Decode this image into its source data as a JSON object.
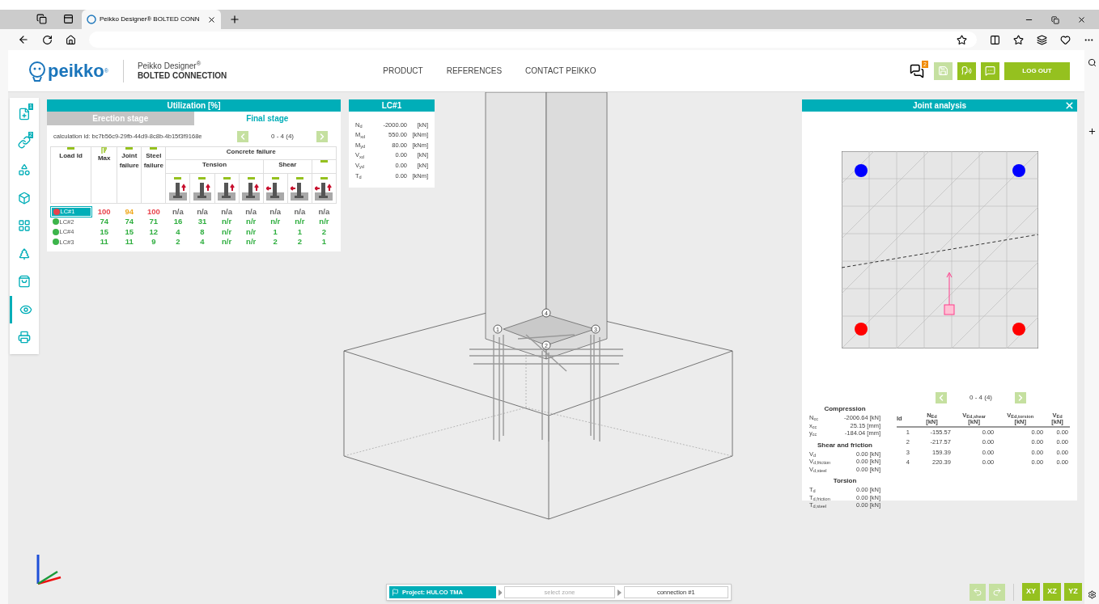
{
  "browser": {
    "tab_title": "Peikko Designer® BOLTED CONN"
  },
  "header": {
    "logo": "peikko",
    "logo_mark": "®",
    "product": "Peikko Designer$^{®}$",
    "subtitle": "BOLTED CONNECTION",
    "nav": [
      "PRODUCT",
      "REFERENCES",
      "CONTACT PEIKKO"
    ],
    "notification_count": "2",
    "save_disabled": true,
    "logout": "LOG OUT"
  },
  "sidebar": {
    "items": [
      {
        "kind": "add",
        "badge": "1",
        "selected": false
      },
      {
        "kind": "link",
        "badge": "2",
        "selected": false
      },
      {
        "kind": "shapes",
        "selected": false
      },
      {
        "kind": "cube",
        "selected": false
      },
      {
        "kind": "grid",
        "selected": false
      },
      {
        "kind": "tree",
        "selected": false
      },
      {
        "kind": "bag",
        "selected": false
      },
      {
        "kind": "view",
        "selected": true
      },
      {
        "kind": "print",
        "selected": false
      }
    ]
  },
  "utilization": {
    "title": "Utilization [%]",
    "tabs": [
      {
        "label": "Erection stage",
        "selected": false
      },
      {
        "label": "Final stage",
        "selected": true
      }
    ],
    "calc_id": "calculation id: bc7b56c9-29fb-44d9-8c8b-4b15f3f9168e",
    "page": "0 - 4 (4)",
    "columns": {
      "load_id": "Load Id",
      "max": "Max",
      "joint": "Joint failure",
      "steel": "Steel failure",
      "concrete": "Concrete failure",
      "tension": "Tension",
      "shear": "Shear"
    },
    "rows": [
      {
        "id": "LC#1",
        "color": "#e8424b",
        "selected": true,
        "cells": [
          {
            "v": "100",
            "color": "#e8424b"
          },
          {
            "v": "94",
            "color": "#f0a81c"
          },
          {
            "v": "100",
            "color": "#e8424b"
          },
          {
            "v": "n/a",
            "color": "#666666"
          },
          {
            "v": "n/a",
            "color": "#666666"
          },
          {
            "v": "n/a",
            "color": "#666666"
          },
          {
            "v": "n/a",
            "color": "#666666"
          },
          {
            "v": "n/a",
            "color": "#666666"
          },
          {
            "v": "n/a",
            "color": "#666666"
          },
          {
            "v": "n/a",
            "color": "#666666"
          }
        ]
      },
      {
        "id": "LC#2",
        "color": "#3cb44a",
        "selected": false,
        "cells": [
          {
            "v": "74",
            "color": "#2fae3f"
          },
          {
            "v": "74",
            "color": "#2fae3f"
          },
          {
            "v": "71",
            "color": "#2fae3f"
          },
          {
            "v": "16",
            "color": "#2fae3f"
          },
          {
            "v": "31",
            "color": "#2fae3f"
          },
          {
            "v": "n/r",
            "color": "#2fae3f"
          },
          {
            "v": "n/r",
            "color": "#2fae3f"
          },
          {
            "v": "n/r",
            "color": "#2fae3f"
          },
          {
            "v": "n/r",
            "color": "#2fae3f"
          },
          {
            "v": "n/r",
            "color": "#2fae3f"
          }
        ]
      },
      {
        "id": "LC#4",
        "color": "#3cb44a",
        "selected": false,
        "cells": [
          {
            "v": "15",
            "color": "#2fae3f"
          },
          {
            "v": "15",
            "color": "#2fae3f"
          },
          {
            "v": "12",
            "color": "#2fae3f"
          },
          {
            "v": "4",
            "color": "#2fae3f"
          },
          {
            "v": "8",
            "color": "#2fae3f"
          },
          {
            "v": "n/r",
            "color": "#2fae3f"
          },
          {
            "v": "n/r",
            "color": "#2fae3f"
          },
          {
            "v": "1",
            "color": "#2fae3f"
          },
          {
            "v": "1",
            "color": "#2fae3f"
          },
          {
            "v": "2",
            "color": "#2fae3f"
          }
        ]
      },
      {
        "id": "LC#3",
        "color": "#3cb44a",
        "selected": false,
        "cells": [
          {
            "v": "11",
            "color": "#2fae3f"
          },
          {
            "v": "11",
            "color": "#2fae3f"
          },
          {
            "v": "9",
            "color": "#2fae3f"
          },
          {
            "v": "2",
            "color": "#2fae3f"
          },
          {
            "v": "4",
            "color": "#2fae3f"
          },
          {
            "v": "n/r",
            "color": "#2fae3f"
          },
          {
            "v": "n/r",
            "color": "#2fae3f"
          },
          {
            "v": "2",
            "color": "#2fae3f"
          },
          {
            "v": "2",
            "color": "#2fae3f"
          },
          {
            "v": "1",
            "color": "#2fae3f"
          }
        ]
      }
    ]
  },
  "load_case": {
    "title": "LC#1",
    "rows": [
      {
        "label": "N$_{d}$",
        "value": "-2000.00",
        "unit": "[kN]"
      },
      {
        "label": "M$_{xd}$",
        "value": "550.00",
        "unit": "[kNm]"
      },
      {
        "label": "M$_{yd}$",
        "value": "80.00",
        "unit": "[kNm]"
      },
      {
        "label": "V$_{xd}$",
        "value": "0.00",
        "unit": "[kN]"
      },
      {
        "label": "V$_{yd}$",
        "value": "0.00",
        "unit": "[kN]"
      },
      {
        "label": "T$_{d}$",
        "value": "0.00",
        "unit": "[kNm]"
      }
    ]
  },
  "scene": {
    "markers": [
      "1",
      "4",
      "2",
      "3"
    ]
  },
  "joint": {
    "title": "Joint analysis",
    "bolts": [
      {
        "color": "#0000ff"
      },
      {
        "color": "#0000ff"
      },
      {
        "color": "#ff0000"
      },
      {
        "color": "#ff0000"
      }
    ],
    "page": "0 - 4 (4)",
    "sections": [
      {
        "title": "Compression",
        "rows": [
          {
            "label": "N$_{cc}$",
            "value": "-2006.64 [kN]"
          },
          {
            "label": "x$_{cc}$",
            "value": "25.15 [mm]"
          },
          {
            "label": "y$_{cc}$",
            "value": "-184.04 [mm]"
          }
        ]
      },
      {
        "title": "Shear and friction",
        "rows": [
          {
            "label": "V$_{d}$",
            "value": "0.00 [kN]"
          },
          {
            "label": "V$_{d,friction}$",
            "value": "0.00 [kN]"
          },
          {
            "label": "V$_{d,steel}$",
            "value": "0.00 [kN]"
          }
        ]
      },
      {
        "title": "Torsion",
        "rows": [
          {
            "label": "T$_{d}$",
            "value": "0.00 [kN]"
          },
          {
            "label": "T$_{d,friction}$",
            "value": "0.00 [kN]"
          },
          {
            "label": "T$_{d,steel}$",
            "value": "0.00 [kN]"
          }
        ]
      }
    ],
    "table": {
      "columns": [
        {
          "name": "Id"
        },
        {
          "name": "N$_{Ed}$",
          "unit": "[kN]"
        },
        {
          "name": "V$_{Ed,shear}$",
          "unit": "[kN]"
        },
        {
          "name": "V$_{Ed,torsion}$",
          "unit": "[kN]"
        },
        {
          "name": "V$_{Ed}$",
          "unit": "[kN]"
        }
      ],
      "rows": [
        [
          "1",
          "-155.57",
          "0.00",
          "0.00",
          "0.00"
        ],
        [
          "2",
          "-217.57",
          "0.00",
          "0.00",
          "0.00"
        ],
        [
          "3",
          "159.39",
          "0.00",
          "0.00",
          "0.00"
        ],
        [
          "4",
          "220.39",
          "0.00",
          "0.00",
          "0.00"
        ]
      ]
    }
  },
  "bottom": {
    "project": "Project: HULCO TMA",
    "zone_placeholder": "select zone",
    "connection": "connection #1",
    "undo_disabled": true,
    "redo_disabled": true,
    "views": [
      "XY",
      "XZ",
      "YZ"
    ]
  }
}
